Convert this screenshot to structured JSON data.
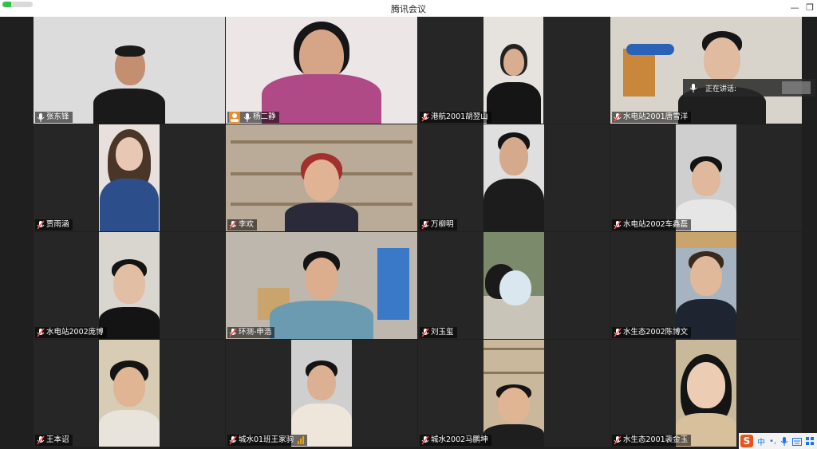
{
  "window": {
    "title": "腾讯会议",
    "minimize_glyph": "—",
    "restore_glyph": "❐",
    "network_signal_fraction": 0.3
  },
  "speaking_indicator": {
    "text": "正在讲话:"
  },
  "participants": [
    {
      "name": "张东锋"
    },
    {
      "name": "杨二静"
    },
    {
      "name": "港航2001胡翌山"
    },
    {
      "name": "水电站2001唐雪洋"
    },
    {
      "name": "贾雨涵"
    },
    {
      "name": "李欢"
    },
    {
      "name": "万柳明"
    },
    {
      "name": "水电站2002车鑫磊"
    },
    {
      "name": "水电站2002庞博"
    },
    {
      "name": "环测-申浩"
    },
    {
      "name": "刘玉玺"
    },
    {
      "name": "水生态2002陈博文"
    },
    {
      "name": "王本诏"
    },
    {
      "name": "城水01班王家驹"
    },
    {
      "name": "城水2002马鹏坤"
    },
    {
      "name": "水生态2001裴金玉"
    }
  ],
  "ime": {
    "logo": "S",
    "lang": "中",
    "punct": "•,",
    "mic": "mic-icon",
    "keyboard": "keyboard-icon",
    "more": "grid-icon"
  },
  "colors": {
    "accent_orange": "#f08a24",
    "signal_green": "#33c14d"
  }
}
